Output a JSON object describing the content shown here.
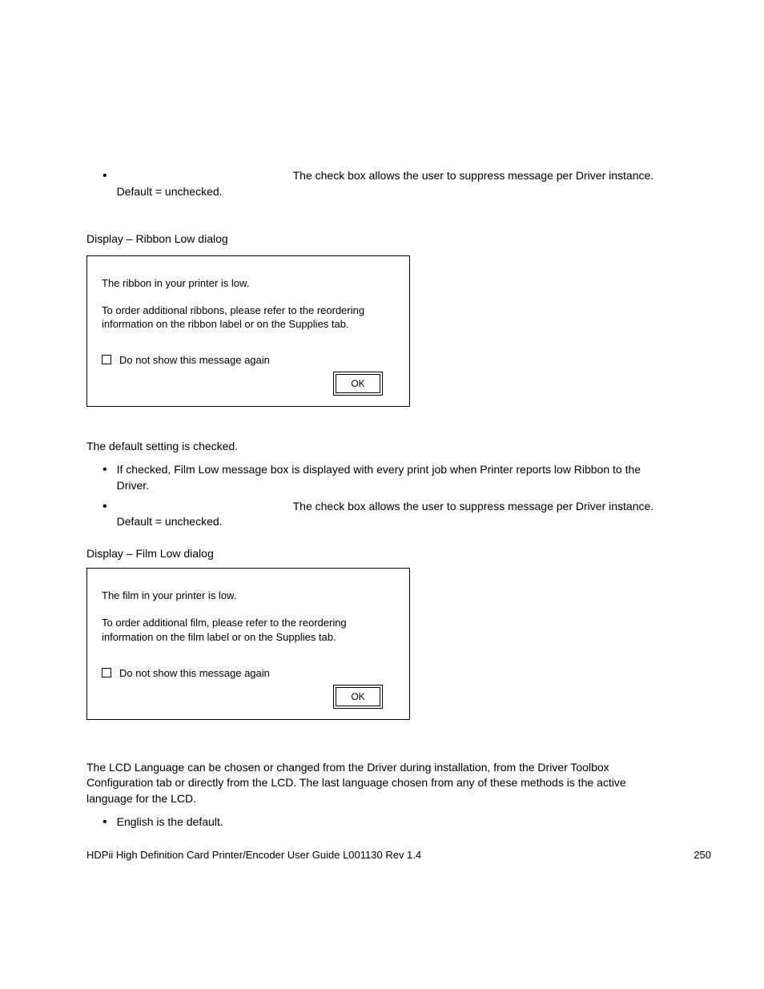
{
  "top_bullet": {
    "text": "The check box allows the user to suppress message per Driver instance. Default = unchecked."
  },
  "section1": {
    "label": "Display – Ribbon Low dialog"
  },
  "dialog1": {
    "line1": "The ribbon in your printer is low.",
    "line2": "To order additional ribbons, please refer to the reordering information on the ribbon label or on the Supplies tab.",
    "checkbox_label": "Do not show this message again",
    "ok": "OK"
  },
  "mid": {
    "para1": "The default setting is checked.",
    "bullet1": "If checked, Film Low message box is displayed with every print job when Printer reports low Ribbon to the Driver.",
    "bullet2": "The check box allows the user to suppress message per Driver instance. Default = unchecked."
  },
  "section2": {
    "label": "Display – Film Low dialog"
  },
  "dialog2": {
    "line1": "The film in your printer is low.",
    "line2": "To order additional film, please refer to the reordering information on the film label or on the Supplies tab.",
    "checkbox_label": "Do not show this message again",
    "ok": "OK"
  },
  "lcd": {
    "para": "The LCD Language can be chosen or changed from the Driver during installation, from the Driver Toolbox Configuration tab or directly from the LCD. The last language chosen from any of these methods is the active language for the LCD.",
    "bullet": "English is the default."
  },
  "footer": {
    "left": "HDPii High Definition Card Printer/Encoder User Guide    L001130 Rev 1.4",
    "right": "250"
  }
}
